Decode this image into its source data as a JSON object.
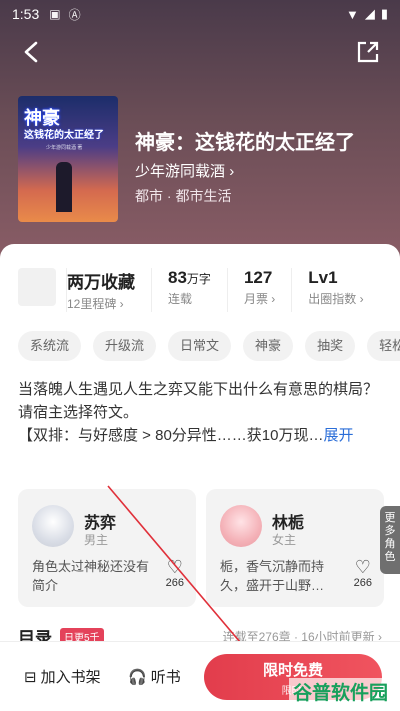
{
  "status_bar": {
    "time": "1:53"
  },
  "book": {
    "title": "神豪：这钱花的太正经了",
    "author": "少年游同载酒",
    "author_chevron": "›",
    "genre": "都市 · 都市生活",
    "cover_title": "神豪",
    "cover_subtitle": "这钱花的太正经了",
    "cover_author": "少年游同载酒 著"
  },
  "stats": [
    {
      "value": "两万收藏",
      "unit": "",
      "label": "12里程碑 ›"
    },
    {
      "value": "83",
      "unit": "万字",
      "label": "连载"
    },
    {
      "value": "127",
      "unit": "",
      "label": "月票 ›"
    },
    {
      "value": "Lv1",
      "unit": "",
      "label": "出圈指数 ›"
    }
  ],
  "tags": [
    "系统流",
    "升级流",
    "日常文",
    "神豪",
    "抽奖",
    "轻松"
  ],
  "synopsis": {
    "line1": "当落魄人生遇见人生之弈又能下出什么有意思的棋局？",
    "line2": "请宿主选择符文。",
    "line3": "【双排：与好感度 > 80分异性……获10万现…",
    "expand": "展开"
  },
  "characters": [
    {
      "name": "苏弈",
      "role": "男主",
      "desc": "角色太过神秘还没有简介",
      "likes": "266"
    },
    {
      "name": "林栀",
      "role": "女主",
      "desc": "栀，香气沉静而持久，盛开于山野…",
      "likes": "266"
    }
  ],
  "more_roles": "更多角色",
  "toc": {
    "title": "目录",
    "badge": "日更5千",
    "update": "连载至276章 · 16小时前更新 ›"
  },
  "bottom_bar": {
    "shelf": "加入书架",
    "listen": "听书",
    "free_main": "限时免费",
    "free_sub": "限时:"
  },
  "watermark": "谷普软件园",
  "colors": {
    "accent": "#e23d4c",
    "link": "#2b6ed8",
    "hero": "#6a4d56"
  }
}
